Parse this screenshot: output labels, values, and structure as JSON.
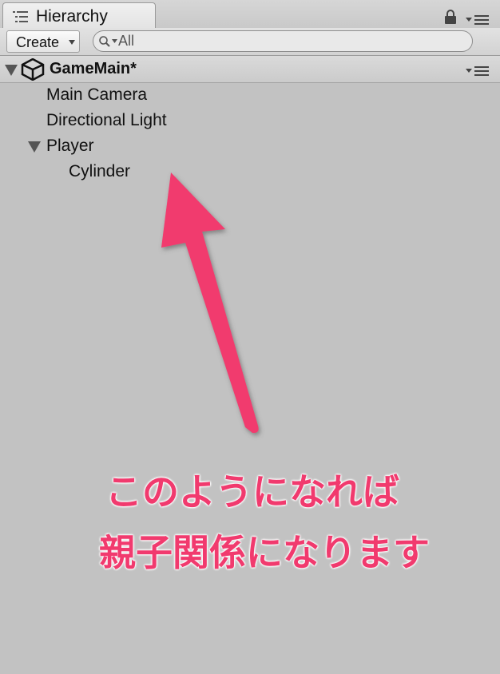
{
  "panel": {
    "tab_label": "Hierarchy"
  },
  "toolbar": {
    "create_label": "Create",
    "search_placeholder": "All"
  },
  "scene": {
    "name": "GameMain*"
  },
  "hierarchy": {
    "items": [
      {
        "label": "Main Camera",
        "depth": 1,
        "expanded": null
      },
      {
        "label": "Directional Light",
        "depth": 1,
        "expanded": null
      },
      {
        "label": "Player",
        "depth": 1,
        "expanded": true
      },
      {
        "label": "Cylinder",
        "depth": 2,
        "expanded": null
      }
    ]
  },
  "annotation": {
    "line1": "このようになれば",
    "line2": "親子関係になります",
    "color": "#f13a6e"
  }
}
